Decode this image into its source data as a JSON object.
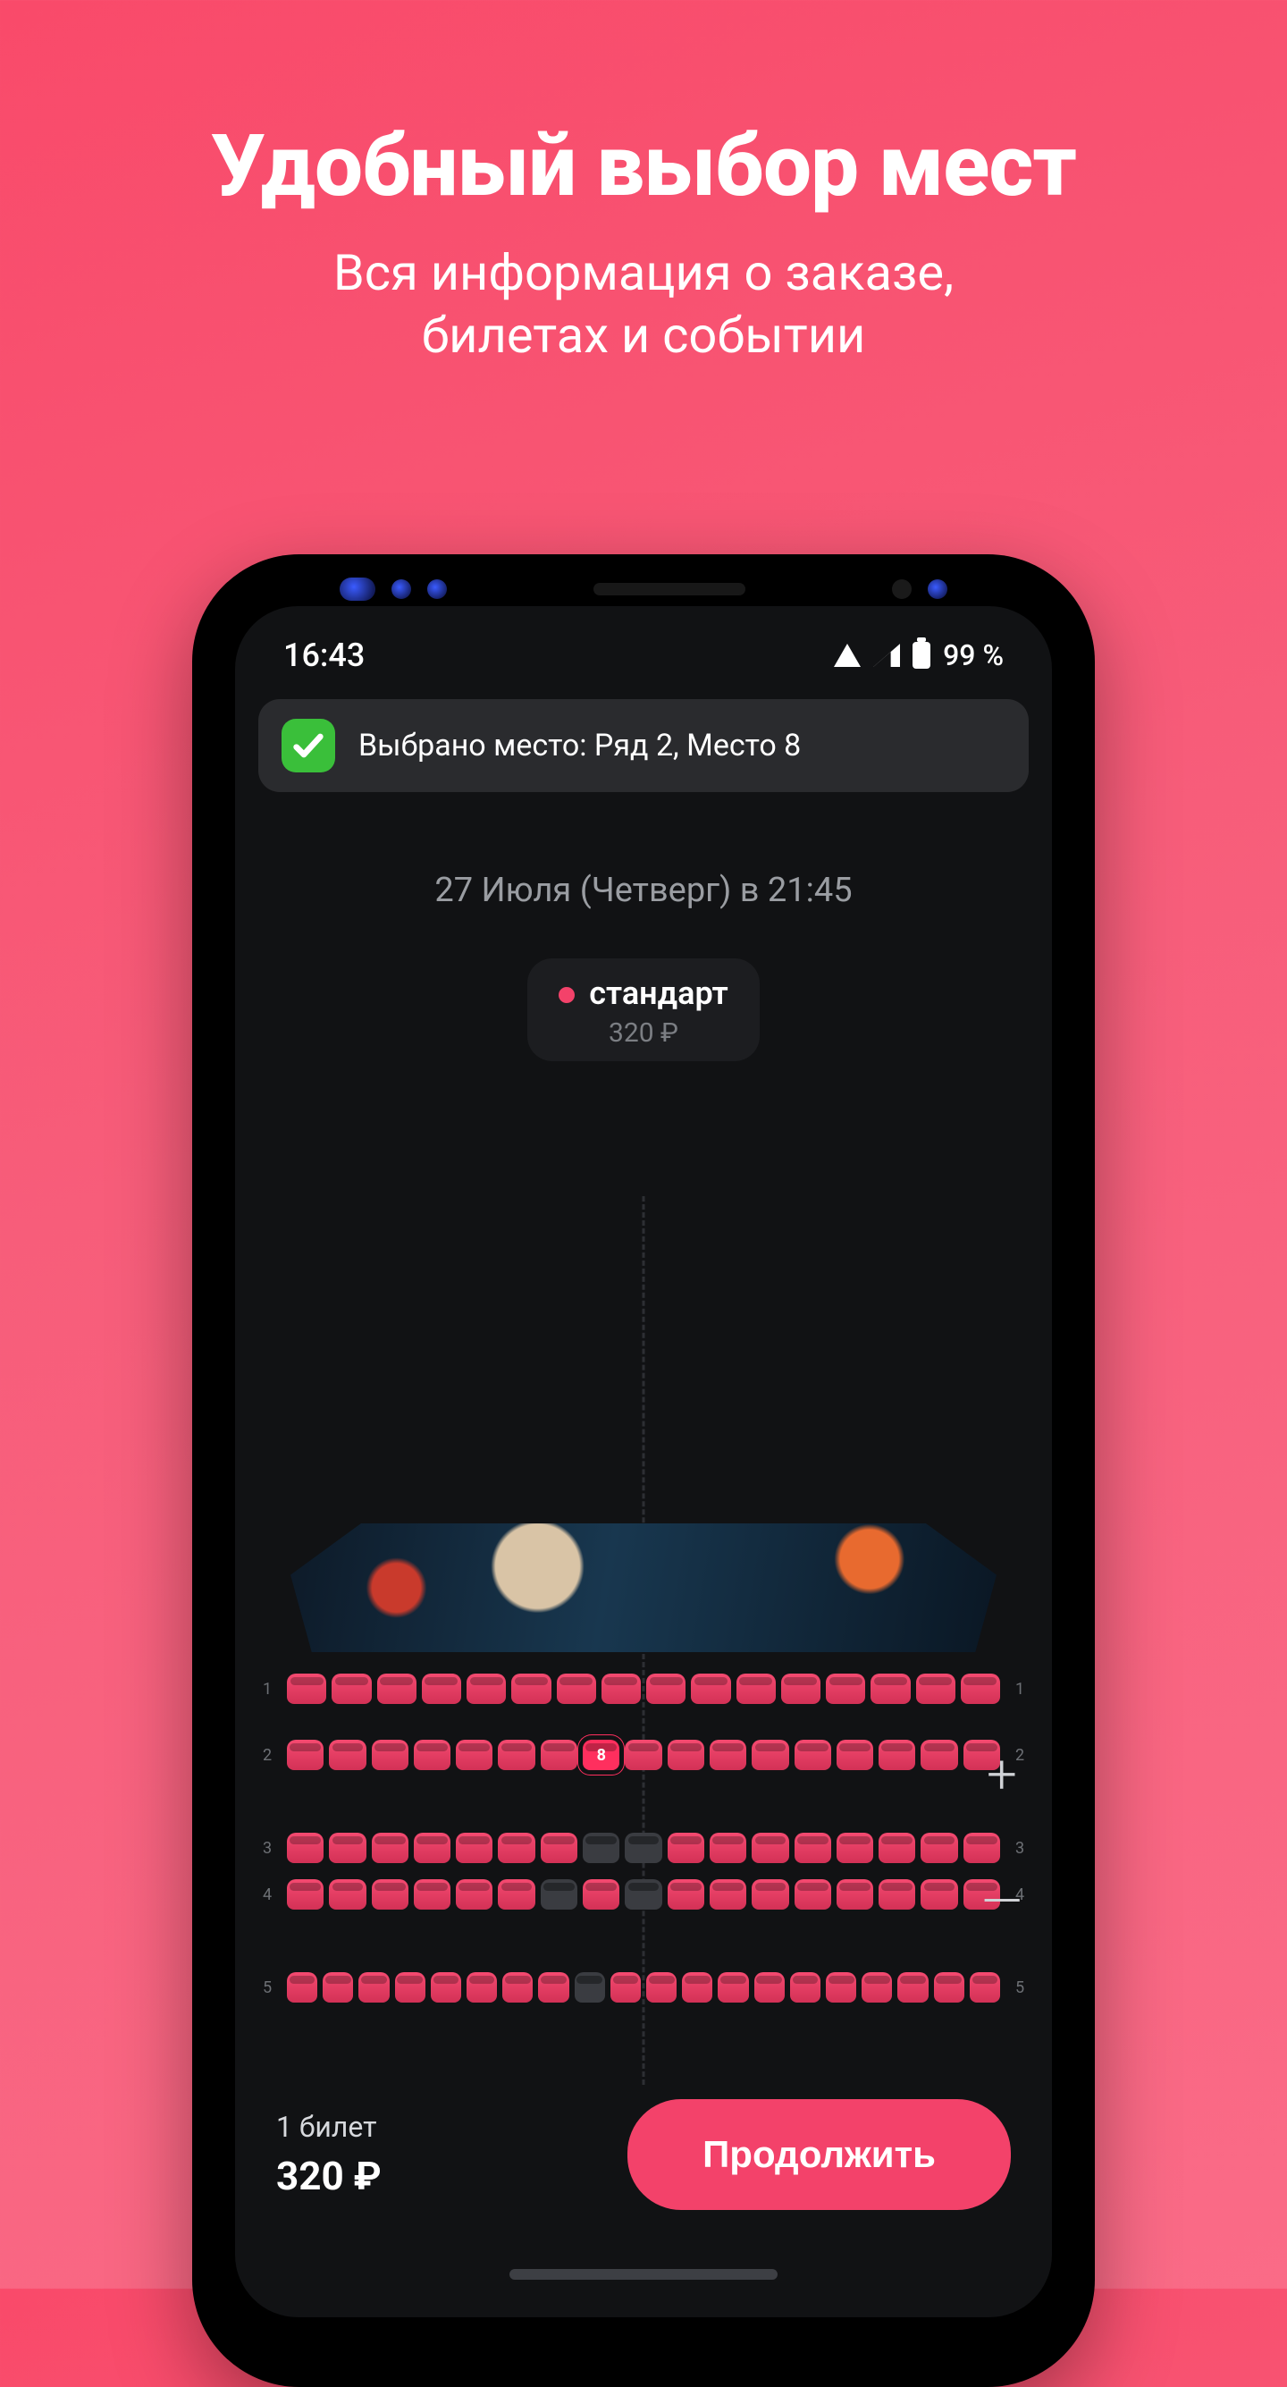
{
  "promo": {
    "title": "Удобный выбор мест",
    "subtitle_l1": "Вся информация о заказе,",
    "subtitle_l2": "билетах и событии"
  },
  "status": {
    "time": "16:43",
    "battery": "99 %"
  },
  "toast": {
    "text": "Выбрано место: Ряд 2, Место 8"
  },
  "session": {
    "datetime": "27 Июля (Четверг) в 21:45"
  },
  "tariff": {
    "name": "стандарт",
    "price": "320 ₽",
    "color": "#f3426a"
  },
  "hall": {
    "rows": [
      {
        "n": "1",
        "gap": "gap",
        "seats": [
          "a",
          "a",
          "a",
          "a",
          "a",
          "a",
          "a",
          "a",
          "a",
          "a",
          "a",
          "a",
          "a",
          "a",
          "a",
          "a"
        ]
      },
      {
        "n": "2",
        "gap": "gap2",
        "seats": [
          "a",
          "a",
          "a",
          "a",
          "a",
          "a",
          "a",
          "sel",
          "a",
          "a",
          "a",
          "a",
          "a",
          "a",
          "a",
          "a",
          "a"
        ],
        "selected_index": 7,
        "selected_label": "8"
      },
      {
        "n": "3",
        "gap": "",
        "seats": [
          "a",
          "a",
          "a",
          "a",
          "a",
          "a",
          "a",
          "off",
          "off",
          "a",
          "a",
          "a",
          "a",
          "a",
          "a",
          "a",
          "a"
        ]
      },
      {
        "n": "4",
        "gap": "gap2",
        "seats": [
          "a",
          "a",
          "a",
          "a",
          "a",
          "a",
          "off",
          "a",
          "off",
          "a",
          "a",
          "a",
          "a",
          "a",
          "a",
          "a",
          "a"
        ]
      },
      {
        "n": "5",
        "gap": "",
        "seats": [
          "a",
          "a",
          "a",
          "a",
          "a",
          "a",
          "a",
          "a",
          "off",
          "a",
          "a",
          "a",
          "a",
          "a",
          "a",
          "a",
          "a",
          "a",
          "a",
          "a"
        ]
      }
    ]
  },
  "zoom": {
    "in": "+",
    "out": "—"
  },
  "footer": {
    "count": "1 билет",
    "total": "320 ₽",
    "cta": "Продолжить"
  }
}
